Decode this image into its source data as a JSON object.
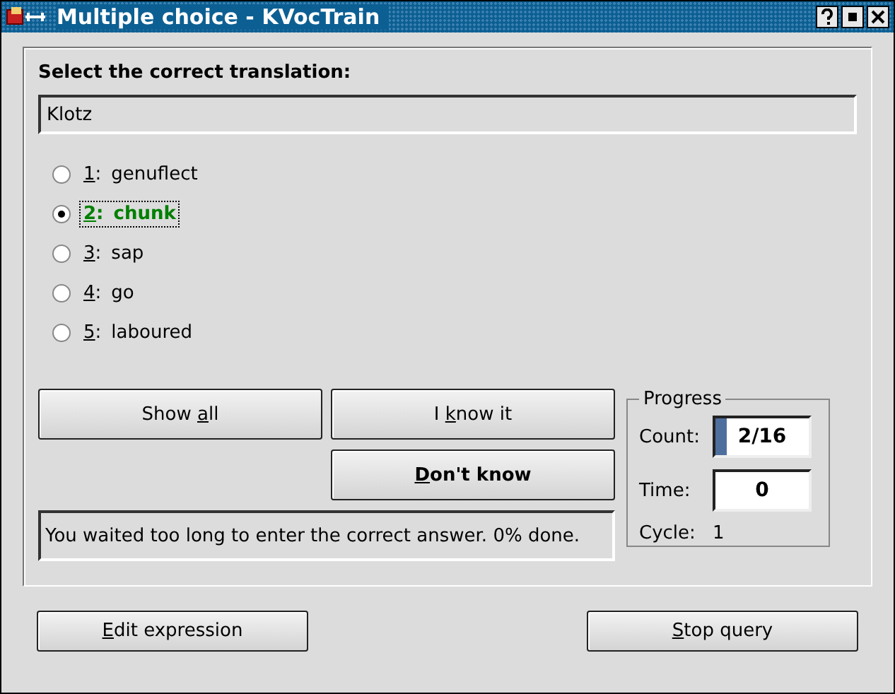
{
  "window": {
    "title": "Multiple choice - KVocTrain"
  },
  "prompt": {
    "label": "Select the correct translation:",
    "word": "Klotz"
  },
  "choices": [
    {
      "number": "1",
      "suffix": ":",
      "text": "genuflect",
      "selected": false
    },
    {
      "number": "2",
      "suffix": ":",
      "text": "chunk",
      "selected": true
    },
    {
      "number": "3",
      "suffix": ":",
      "text": "sap",
      "selected": false
    },
    {
      "number": "4",
      "suffix": ":",
      "text": "go",
      "selected": false
    },
    {
      "number": "5",
      "suffix": ":",
      "text": "laboured",
      "selected": false
    }
  ],
  "actions": {
    "show_all": {
      "before": "Show ",
      "key": "a",
      "after": "ll"
    },
    "know": {
      "before": "I ",
      "key": "k",
      "after": "now it"
    },
    "dont_know": {
      "key": "D",
      "after": "on't know"
    }
  },
  "message": "You waited too long to enter the correct answer. 0% done.",
  "progress": {
    "title": "Progress",
    "count_label": "Count:",
    "count": "2/16",
    "level": 0.125,
    "time_label": "Time:",
    "time": "0",
    "cycle_label": "Cycle:",
    "cycle": "1"
  },
  "footer": {
    "edit": {
      "key": "E",
      "after": "dit expression"
    },
    "stop": {
      "key": "S",
      "after": "top query"
    }
  }
}
